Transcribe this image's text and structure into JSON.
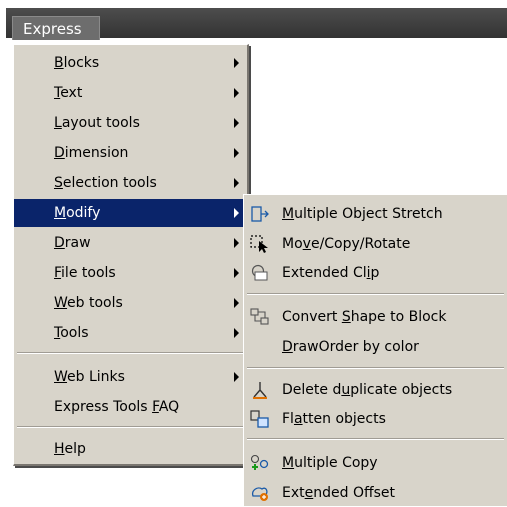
{
  "menubar": {
    "title": "Express"
  },
  "express_menu": [
    {
      "pre": "",
      "u": "B",
      "post": "locks"
    },
    {
      "pre": "",
      "u": "T",
      "post": "ext"
    },
    {
      "pre": "",
      "u": "L",
      "post": "ayout tools"
    },
    {
      "pre": "",
      "u": "D",
      "post": "imension"
    },
    {
      "pre": "",
      "u": "S",
      "post": "election tools"
    },
    {
      "pre": "",
      "u": "M",
      "post": "odify"
    },
    {
      "pre": "",
      "u": "D",
      "post": "raw"
    },
    {
      "pre": "",
      "u": "F",
      "post": "ile tools"
    },
    {
      "pre": "",
      "u": "W",
      "post": "eb tools"
    },
    {
      "pre": "",
      "u": "T",
      "post": "ools"
    },
    {
      "pre": "",
      "u": "W",
      "post": "eb Links"
    },
    {
      "pre": "Express Tools ",
      "u": "F",
      "post": "AQ"
    },
    {
      "pre": "",
      "u": "H",
      "post": "elp"
    }
  ],
  "modify_submenu": [
    {
      "pre": "",
      "u": "M",
      "post": "ultiple Object Stretch",
      "icon": "stretch-icon"
    },
    {
      "pre": "Mo",
      "u": "v",
      "post": "e/Copy/Rotate",
      "icon": "move-copy-rotate-icon"
    },
    {
      "pre": "Extended Cl",
      "u": "i",
      "post": "p",
      "icon": "extended-clip-icon"
    },
    {
      "pre": "Convert ",
      "u": "S",
      "post": "hape to Block",
      "icon": "shape-to-block-icon"
    },
    {
      "pre": "",
      "u": "D",
      "post": "rawOrder by color",
      "icon": ""
    },
    {
      "pre": "Delete d",
      "u": "u",
      "post": "plicate objects",
      "icon": "delete-duplicates-icon"
    },
    {
      "pre": "Fl",
      "u": "a",
      "post": "tten objects",
      "icon": "flatten-icon"
    },
    {
      "pre": "",
      "u": "M",
      "post": "ultiple Copy",
      "icon": "multiple-copy-icon"
    },
    {
      "pre": "Ext",
      "u": "e",
      "post": "nded Offset",
      "icon": "extended-offset-icon"
    }
  ],
  "colors": {
    "highlight": "#0a246a",
    "menu_bg": "#d8d4ca",
    "menubar": "#3f3f3f"
  }
}
